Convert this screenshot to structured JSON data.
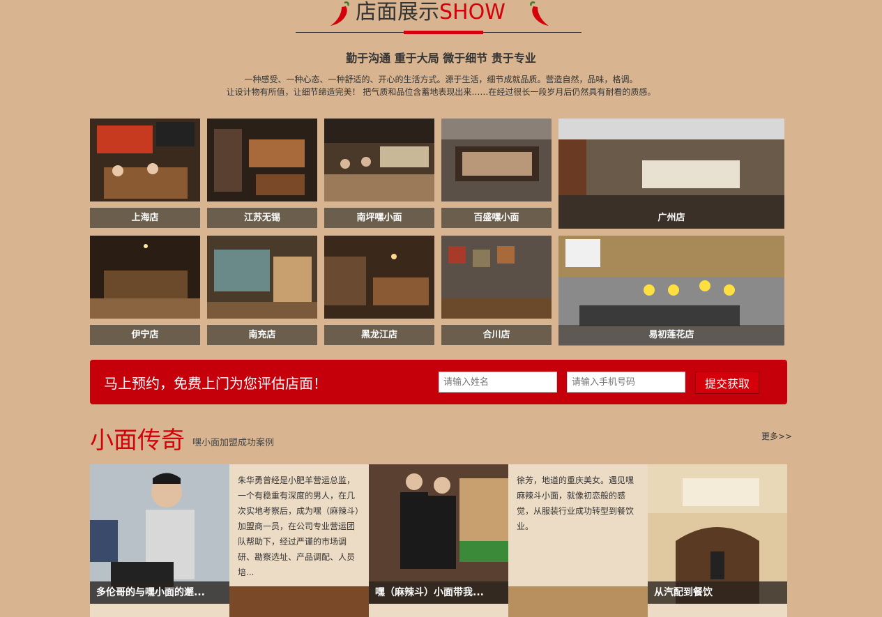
{
  "header": {
    "title_cn": "店面展示",
    "title_en": "SHOW",
    "slogan": "勤于沟通 重于大局 微于细节 贵于专业",
    "intro_line1": "一种感受、一种心态、一种舒适的、开心的生活方式。源于生活，细节成就品质。营造自然，品味，格调。",
    "intro_line2": "让设计物有所值，让细节缔造完美！ 把气质和品位含蓄地表现出来……在经过很长一段岁月后仍然具有耐看的质感。"
  },
  "stores": [
    {
      "label": "上海店"
    },
    {
      "label": "江苏无锡"
    },
    {
      "label": "南坪嘿小面"
    },
    {
      "label": "百盛嘿小面"
    },
    {
      "label": "广州店"
    },
    {
      "label": "伊宁店"
    },
    {
      "label": "南充店"
    },
    {
      "label": "黑龙江店"
    },
    {
      "label": "合川店"
    },
    {
      "label": "易初莲花店"
    }
  ],
  "booking": {
    "headline": "马上预约，免费上门为您评估店面！",
    "name_placeholder": "请输入姓名",
    "phone_placeholder": "请输入手机号码",
    "submit_label": "提交获取"
  },
  "legend": {
    "title": "小面传奇",
    "subtitle": "嘿小面加盟成功案例",
    "more_label": "更多>>",
    "cards": [
      {
        "caption": "多伦哥的与嘿小面的邂...",
        "text": "朱华勇曾经是小肥羊营运总监，一个有稳重有深度的男人，在几次实地考察后，成为嘿（麻辣斗）加盟商一员，在公司专业营运团队帮助下，经过严谨的市场调研、勘察选址、产品调配、人员培..."
      },
      {
        "caption": "嘿（麻辣斗）小面带我...",
        "text": "徐芳，地道的重庆美女。遇见嘿麻辣斗小面，就像初恋般的感觉，从服装行业成功转型到餐饮业。"
      },
      {
        "caption": "从汽配到餐饮",
        "text": ""
      }
    ]
  },
  "colors": {
    "background": "#d8b590",
    "accent_red": "#d4000a",
    "caption_bar": "#6b5e4c"
  }
}
